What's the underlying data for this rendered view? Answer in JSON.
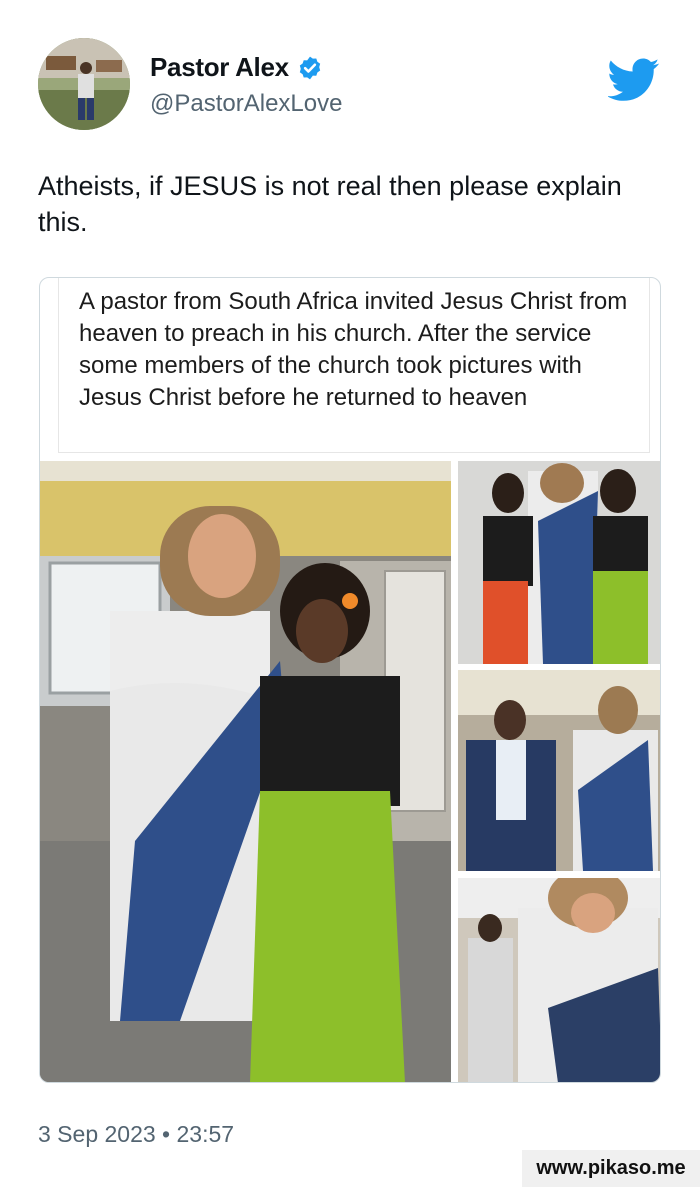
{
  "author": {
    "display_name": "Pastor Alex",
    "handle": "@PastorAlexLove",
    "verified": true,
    "avatar_icon": "profile-photo"
  },
  "platform_icon": "twitter-bird-icon",
  "tweet": {
    "text": "Atheists, if JESUS is not real then please explain this.",
    "timestamp": "3 Sep 2023 • 23:57"
  },
  "attachment": {
    "caption": "A pastor from South Africa invited Jesus Christ from heaven to preach in his church. After the service some members of the church took pictures with Jesus Christ before he returned to heaven"
  },
  "watermark": "www.pikaso.me",
  "colors": {
    "twitter_blue": "#1d9bf0",
    "text_primary": "#0f1419",
    "text_secondary": "#536471"
  }
}
